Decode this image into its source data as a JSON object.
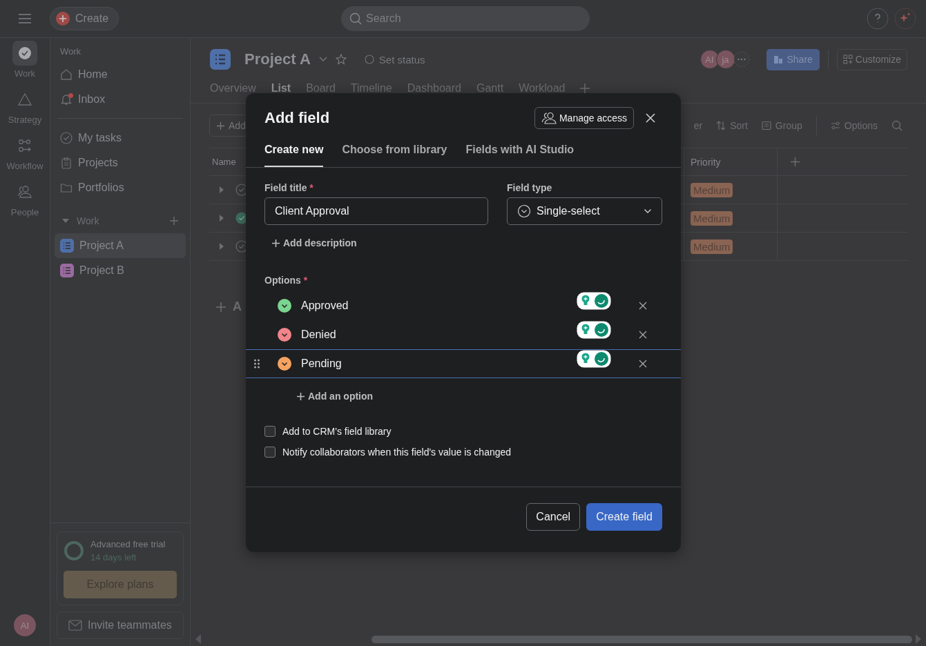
{
  "top_bar": {
    "create": "Create",
    "search_placeholder": "Search"
  },
  "rail": [
    {
      "label": "Work",
      "kind": "check",
      "selected": true
    },
    {
      "label": "Strategy",
      "kind": "triangle",
      "selected": false
    },
    {
      "label": "Workflow",
      "kind": "flow",
      "selected": false
    },
    {
      "label": "People",
      "kind": "people",
      "selected": false
    }
  ],
  "user_avatar": "AI",
  "sidebar": {
    "heading": "Work",
    "items": [
      {
        "label": "Home",
        "kind": "home",
        "unread": false
      },
      {
        "label": "Inbox",
        "kind": "bell",
        "unread": true
      }
    ],
    "items2": [
      {
        "label": "My tasks",
        "kind": "check"
      },
      {
        "label": "Projects",
        "kind": "clipboard"
      },
      {
        "label": "Portfolios",
        "kind": "folder"
      }
    ],
    "section": {
      "label": "Work",
      "expanded": true
    },
    "projects": [
      {
        "label": "Project A",
        "color": "#4f6fa8",
        "selected": true
      },
      {
        "label": "Project B",
        "color": "#9a6aa0",
        "selected": false
      }
    ],
    "trial": {
      "title": "Advanced free trial",
      "subtitle": "14 days left",
      "button": "Explore plans"
    },
    "invite": "Invite teammates"
  },
  "project": {
    "title": "Project A",
    "set_status": "Set status",
    "members": [
      "AI",
      "ja"
    ],
    "share": "Share",
    "customize": "Customize",
    "tabs": [
      {
        "label": "Overview",
        "selected": false
      },
      {
        "label": "List",
        "selected": true
      },
      {
        "label": "Board",
        "selected": false
      },
      {
        "label": "Timeline",
        "selected": false
      },
      {
        "label": "Dashboard",
        "selected": false
      },
      {
        "label": "Gantt",
        "selected": false
      },
      {
        "label": "Workload",
        "selected": false
      }
    ]
  },
  "toolbar": {
    "add": "Add",
    "filter": "er",
    "sort": "Sort",
    "group": "Group",
    "options": "Options"
  },
  "table": {
    "name_header": "Name",
    "priority_header": "Priority",
    "rows": [
      {
        "done": false,
        "priority": "Medium"
      },
      {
        "done": true,
        "priority": "Medium"
      },
      {
        "done": false,
        "priority": "Medium"
      }
    ],
    "add_section": "A"
  },
  "dialog": {
    "title": "Add field",
    "manage_access": "Manage access",
    "tabs": [
      {
        "label": "Create new",
        "selected": true
      },
      {
        "label": "Choose from library",
        "selected": false
      },
      {
        "label": "Fields with AI Studio",
        "selected": false
      }
    ],
    "field_title": {
      "label": "Field title",
      "required_mark": "*",
      "value": "Client Approval"
    },
    "field_type": {
      "label": "Field type",
      "value": "Single-select"
    },
    "add_description": "Add description",
    "options_label": "Options",
    "options_required_mark": "*",
    "options": [
      {
        "label": "Approved",
        "color": "#7ad58f",
        "focused": false
      },
      {
        "label": "Denied",
        "color": "#f1858a",
        "focused": false
      },
      {
        "label": "Pending",
        "color": "#f5a35f",
        "focused": true
      }
    ],
    "add_option": "Add an option",
    "checkboxes": [
      {
        "label": "Add to CRM's field library",
        "checked": false
      },
      {
        "label": "Notify collaborators when this field's value is changed",
        "checked": false
      }
    ],
    "cancel": "Cancel",
    "create": "Create field"
  }
}
